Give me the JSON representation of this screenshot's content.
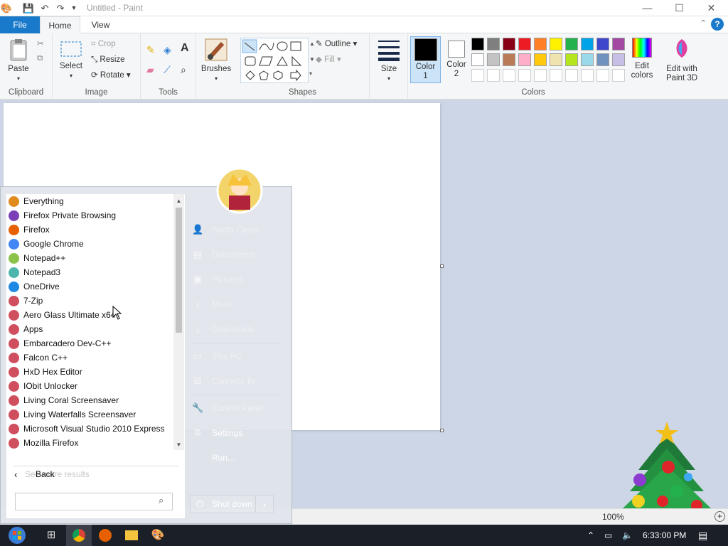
{
  "window": {
    "title": "Untitled - Paint",
    "minimize": "—",
    "maximize": "☐",
    "close": "✕"
  },
  "tabs": {
    "file": "File",
    "home": "Home",
    "view": "View",
    "help": "?"
  },
  "ribbon": {
    "clipboard": {
      "paste": "Paste",
      "label": "Clipboard"
    },
    "image": {
      "select": "Select",
      "crop": "Crop",
      "resize": "Resize",
      "rotate": "Rotate",
      "label": "Image"
    },
    "tools": {
      "label": "Tools"
    },
    "brushes": {
      "label": "Brushes"
    },
    "shapes": {
      "outline": "Outline",
      "fill": "Fill",
      "label": "Shapes"
    },
    "size": {
      "label": "Size"
    },
    "colors": {
      "color1": "Color\n1",
      "color2": "Color\n2",
      "edit_colors": "Edit\ncolors",
      "edit_paint3d": "Edit with\nPaint 3D",
      "label": "Colors",
      "palette_row1": [
        "#000000",
        "#7f7f7f",
        "#880015",
        "#ed1c24",
        "#ff7f27",
        "#fff200",
        "#22b14c",
        "#00a2e8",
        "#3f48cc",
        "#a349a4"
      ],
      "palette_row2": [
        "#ffffff",
        "#c3c3c3",
        "#b97a57",
        "#ffaec9",
        "#ffc90e",
        "#efe4b0",
        "#b5e61d",
        "#99d9ea",
        "#7092be",
        "#c8bfe7"
      ]
    }
  },
  "status": {
    "zoom": "100%"
  },
  "start_menu": {
    "programs": [
      {
        "label": "Everything",
        "color": "#e08a1e"
      },
      {
        "label": "Firefox Private Browsing",
        "color": "#7a3fb8"
      },
      {
        "label": "Firefox",
        "color": "#e66000"
      },
      {
        "label": "Google Chrome",
        "color": "#4285f4"
      },
      {
        "label": "Notepad++",
        "color": "#8bc34a"
      },
      {
        "label": "Notepad3",
        "color": "#4db6ac"
      },
      {
        "label": "OneDrive",
        "color": "#1e88e5"
      },
      {
        "label": "7-Zip",
        "color": "#d04f5f"
      },
      {
        "label": "Aero Glass Ultimate x64",
        "color": "#d04f5f"
      },
      {
        "label": "Apps",
        "color": "#d04f5f"
      },
      {
        "label": "Embarcadero Dev-C++",
        "color": "#d04f5f"
      },
      {
        "label": "Falcon C++",
        "color": "#d04f5f"
      },
      {
        "label": "HxD Hex Editor",
        "color": "#d04f5f"
      },
      {
        "label": "IObit Unlocker",
        "color": "#d04f5f"
      },
      {
        "label": "Living Coral Screensaver",
        "color": "#d04f5f"
      },
      {
        "label": "Living Waterfalls Screensaver",
        "color": "#d04f5f"
      },
      {
        "label": "Microsoft Visual Studio 2010 Express",
        "color": "#d04f5f"
      },
      {
        "label": "Mozilla Firefox",
        "color": "#d04f5f"
      }
    ],
    "back": "Back",
    "back_ghost": "See more results",
    "search_placeholder": "",
    "right_items": {
      "user": "Santa Claus",
      "documents": "Documents",
      "pictures": "Pictures",
      "music": "Music",
      "downloads": "Downloads",
      "this_pc": "This PC",
      "connect_to": "Connect To",
      "control_panel": "Control Panel",
      "settings": "Settings",
      "run": "Run..."
    },
    "shutdown": "Shut down"
  },
  "taskbar": {
    "time": "6:33:00 PM"
  }
}
